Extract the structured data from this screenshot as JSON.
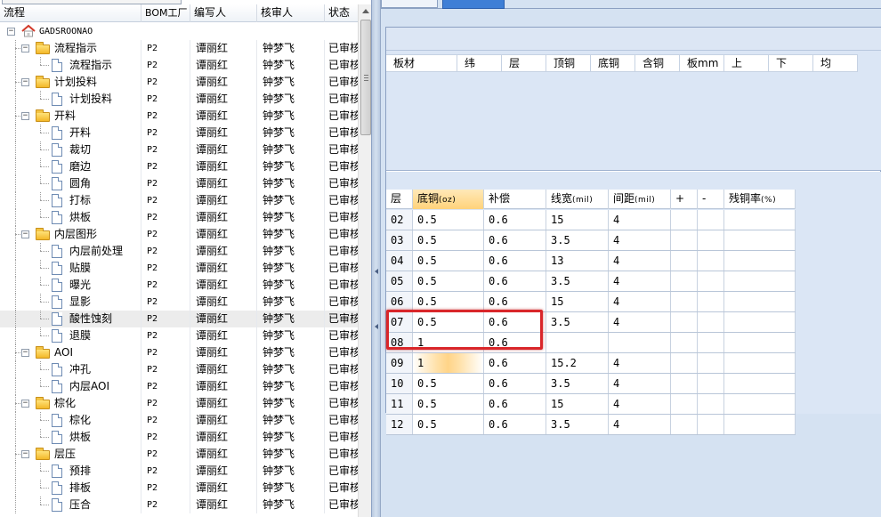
{
  "left_grid": {
    "columns": [
      "流程",
      "BOM工厂",
      "编写人",
      "核审人",
      "状态"
    ],
    "root_label": "GADSROONAO",
    "rows": [
      {
        "label": "流程指示",
        "level": 1,
        "type": "folder",
        "factory": "P2",
        "editor": "谭丽红",
        "reviewer": "钟梦飞",
        "status": "已审核"
      },
      {
        "label": "流程指示",
        "level": 2,
        "type": "doc",
        "factory": "P2",
        "editor": "谭丽红",
        "reviewer": "钟梦飞",
        "status": "已审核"
      },
      {
        "label": "计划投料",
        "level": 1,
        "type": "folder",
        "factory": "P2",
        "editor": "谭丽红",
        "reviewer": "钟梦飞",
        "status": "已审核"
      },
      {
        "label": "计划投料",
        "level": 2,
        "type": "doc",
        "factory": "P2",
        "editor": "谭丽红",
        "reviewer": "钟梦飞",
        "status": "已审核"
      },
      {
        "label": "开料",
        "level": 1,
        "type": "folder",
        "factory": "P2",
        "editor": "谭丽红",
        "reviewer": "钟梦飞",
        "status": "已审核"
      },
      {
        "label": "开料",
        "level": 2,
        "type": "doc",
        "factory": "P2",
        "editor": "谭丽红",
        "reviewer": "钟梦飞",
        "status": "已审核"
      },
      {
        "label": "裁切",
        "level": 2,
        "type": "doc",
        "factory": "P2",
        "editor": "谭丽红",
        "reviewer": "钟梦飞",
        "status": "已审核"
      },
      {
        "label": "磨边",
        "level": 2,
        "type": "doc",
        "factory": "P2",
        "editor": "谭丽红",
        "reviewer": "钟梦飞",
        "status": "已审核"
      },
      {
        "label": "圆角",
        "level": 2,
        "type": "doc",
        "factory": "P2",
        "editor": "谭丽红",
        "reviewer": "钟梦飞",
        "status": "已审核"
      },
      {
        "label": "打标",
        "level": 2,
        "type": "doc",
        "factory": "P2",
        "editor": "谭丽红",
        "reviewer": "钟梦飞",
        "status": "已审核"
      },
      {
        "label": "烘板",
        "level": 2,
        "type": "doc",
        "factory": "P2",
        "editor": "谭丽红",
        "reviewer": "钟梦飞",
        "status": "已审核"
      },
      {
        "label": "内层图形",
        "level": 1,
        "type": "folder",
        "factory": "P2",
        "editor": "谭丽红",
        "reviewer": "钟梦飞",
        "status": "已审核"
      },
      {
        "label": "内层前处理",
        "level": 2,
        "type": "doc",
        "factory": "P2",
        "editor": "谭丽红",
        "reviewer": "钟梦飞",
        "status": "已审核"
      },
      {
        "label": "贴膜",
        "level": 2,
        "type": "doc",
        "factory": "P2",
        "editor": "谭丽红",
        "reviewer": "钟梦飞",
        "status": "已审核"
      },
      {
        "label": "曝光",
        "level": 2,
        "type": "doc",
        "factory": "P2",
        "editor": "谭丽红",
        "reviewer": "钟梦飞",
        "status": "已审核"
      },
      {
        "label": "显影",
        "level": 2,
        "type": "doc",
        "factory": "P2",
        "editor": "谭丽红",
        "reviewer": "钟梦飞",
        "status": "已审核"
      },
      {
        "label": "酸性蚀刻",
        "level": 2,
        "type": "doc",
        "factory": "P2",
        "editor": "谭丽红",
        "reviewer": "钟梦飞",
        "status": "已审核",
        "selected": true
      },
      {
        "label": "退膜",
        "level": 2,
        "type": "doc",
        "factory": "P2",
        "editor": "谭丽红",
        "reviewer": "钟梦飞",
        "status": "已审核"
      },
      {
        "label": "AOI",
        "level": 1,
        "type": "folder",
        "factory": "P2",
        "editor": "谭丽红",
        "reviewer": "钟梦飞",
        "status": "已审核"
      },
      {
        "label": "冲孔",
        "level": 2,
        "type": "doc",
        "factory": "P2",
        "editor": "谭丽红",
        "reviewer": "钟梦飞",
        "status": "已审核"
      },
      {
        "label": "内层AOI",
        "level": 2,
        "type": "doc",
        "factory": "P2",
        "editor": "谭丽红",
        "reviewer": "钟梦飞",
        "status": "已审核"
      },
      {
        "label": "棕化",
        "level": 1,
        "type": "folder",
        "factory": "P2",
        "editor": "谭丽红",
        "reviewer": "钟梦飞",
        "status": "已审核"
      },
      {
        "label": "棕化",
        "level": 2,
        "type": "doc",
        "factory": "P2",
        "editor": "谭丽红",
        "reviewer": "钟梦飞",
        "status": "已审核"
      },
      {
        "label": "烘板",
        "level": 2,
        "type": "doc",
        "factory": "P2",
        "editor": "谭丽红",
        "reviewer": "钟梦飞",
        "status": "已审核"
      },
      {
        "label": "层压",
        "level": 1,
        "type": "folder",
        "factory": "P2",
        "editor": "谭丽红",
        "reviewer": "钟梦飞",
        "status": "已审核"
      },
      {
        "label": "预排",
        "level": 2,
        "type": "doc",
        "factory": "P2",
        "editor": "谭丽红",
        "reviewer": "钟梦飞",
        "status": "已审核"
      },
      {
        "label": "排板",
        "level": 2,
        "type": "doc",
        "factory": "P2",
        "editor": "谭丽红",
        "reviewer": "钟梦飞",
        "status": "已审核"
      },
      {
        "label": "压合",
        "level": 2,
        "type": "doc",
        "factory": "P2",
        "editor": "谭丽红",
        "reviewer": "钟梦飞",
        "status": "已审核"
      }
    ]
  },
  "right_pane": {
    "upper_table": {
      "columns": [
        "板材",
        "纬",
        "层",
        "顶铜",
        "底铜",
        "含铜",
        "板mm",
        "上",
        "下",
        "均"
      ]
    },
    "lower_table": {
      "columns": [
        {
          "main": "层",
          "unit": ""
        },
        {
          "main": "底铜",
          "unit": "(oz)"
        },
        {
          "main": "补偿",
          "unit": ""
        },
        {
          "main": "线宽",
          "unit": "(mil)"
        },
        {
          "main": "间距",
          "unit": "(mil)"
        },
        {
          "main": "+",
          "unit": ""
        },
        {
          "main": "-",
          "unit": ""
        },
        {
          "main": "残铜率",
          "unit": "(%)"
        }
      ],
      "rows": [
        [
          "02",
          "0.5",
          "0.6",
          "15",
          "4",
          "",
          "",
          ""
        ],
        [
          "03",
          "0.5",
          "0.6",
          "3.5",
          "4",
          "",
          "",
          ""
        ],
        [
          "04",
          "0.5",
          "0.6",
          "13",
          "4",
          "",
          "",
          ""
        ],
        [
          "05",
          "0.5",
          "0.6",
          "3.5",
          "4",
          "",
          "",
          ""
        ],
        [
          "06",
          "0.5",
          "0.6",
          "15",
          "4",
          "",
          "",
          ""
        ],
        [
          "07",
          "0.5",
          "0.6",
          "3.5",
          "4",
          "",
          "",
          ""
        ],
        [
          "08",
          "1",
          "0.6",
          "",
          "",
          "",
          "",
          ""
        ],
        [
          "09",
          "1",
          "0.6",
          "15.2",
          "4",
          "",
          "",
          ""
        ],
        [
          "10",
          "0.5",
          "0.6",
          "3.5",
          "4",
          "",
          "",
          ""
        ],
        [
          "11",
          "0.5",
          "0.6",
          "15",
          "4",
          "",
          "",
          ""
        ],
        [
          "12",
          "0.5",
          "0.6",
          "3.5",
          "4",
          "",
          "",
          ""
        ]
      ],
      "active_column": 1,
      "focused_cell": {
        "row": 7,
        "col": 1
      },
      "annotated_rows": [
        6,
        7
      ],
      "annotation_color": "#d9262a"
    }
  },
  "colors": {
    "pane_background": "#d5e2f2",
    "selected_tab": "#3f7fd6",
    "active_header": "#ffd27a"
  }
}
